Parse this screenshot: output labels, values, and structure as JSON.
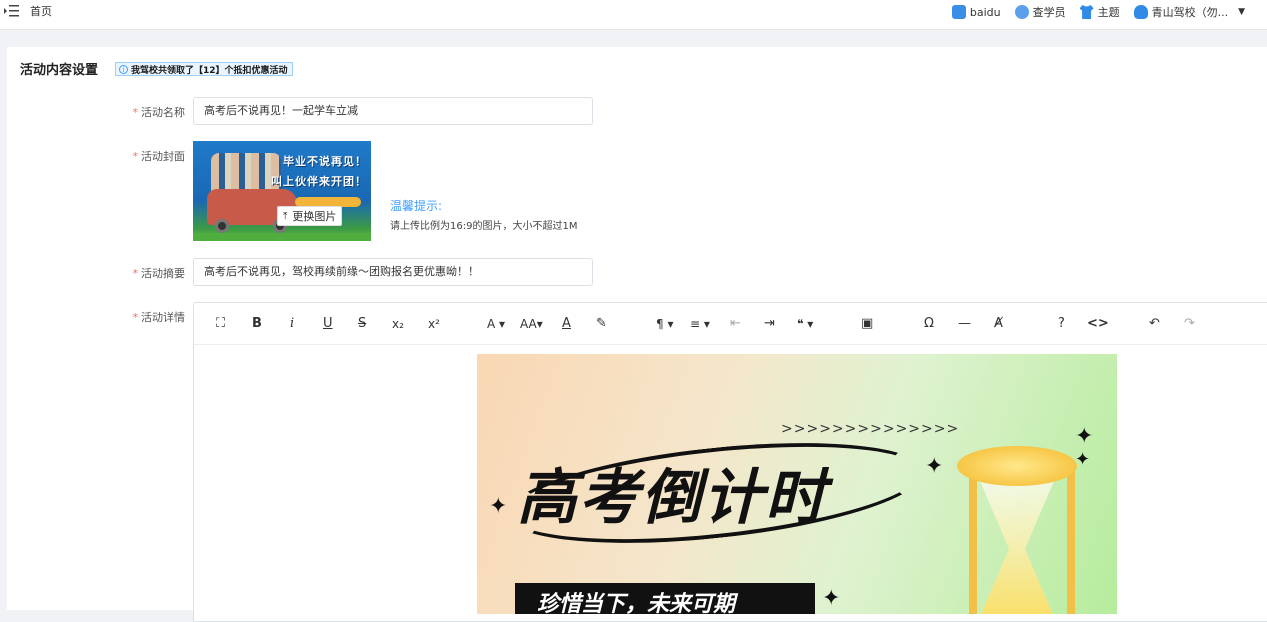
{
  "topbar": {
    "home": "首页",
    "items": [
      {
        "label": "baidu",
        "icon": "baidu-icon"
      },
      {
        "label": "查学员",
        "icon": "search-user-icon"
      },
      {
        "label": "主题",
        "icon": "theme-shirt-icon"
      },
      {
        "label": "青山驾校（勿...",
        "icon": "user-avatar-icon"
      }
    ]
  },
  "section": {
    "title": "活动内容设置",
    "notice": "我驾校共领取了【12】个抵扣优惠活动"
  },
  "form": {
    "name_label": "活动名称",
    "name_value": "高考后不说再见！一起学车立减",
    "cover_label": "活动封面",
    "cover_title_1": "毕业不说再见！",
    "cover_title_2": "叫上伙伴来开团！",
    "replace_label": "更换图片",
    "tip_title": "温馨提示:",
    "tip_text": "请上传比例为16:9的图片，大小不超过1M",
    "summary_label": "活动摘要",
    "summary_value": "高考后不说再见，驾校再续前缘～团购报名更优惠呦！！",
    "detail_label": "活动详情"
  },
  "editor": {
    "toolbar": [
      {
        "name": "fullscreen-button",
        "glyph": "⛶"
      },
      {
        "name": "bold-button",
        "glyph": "B"
      },
      {
        "name": "italic-button",
        "glyph": "i"
      },
      {
        "name": "underline-button",
        "glyph": "U"
      },
      {
        "name": "strikethrough-button",
        "glyph": "S"
      },
      {
        "name": "subscript-button",
        "glyph": "x₂"
      },
      {
        "name": "superscript-button",
        "glyph": "x²"
      },
      {
        "name": "font-color-button",
        "glyph": "A ▾"
      },
      {
        "name": "font-size-button",
        "glyph": "AA▾"
      },
      {
        "name": "background-color-button",
        "glyph": "A"
      },
      {
        "name": "clear-format-brush-button",
        "glyph": "✎"
      },
      {
        "name": "paragraph-button",
        "glyph": "¶ ▾"
      },
      {
        "name": "align-button",
        "glyph": "≡ ▾"
      },
      {
        "name": "outdent-button",
        "glyph": "⇤"
      },
      {
        "name": "indent-button",
        "glyph": "⇥"
      },
      {
        "name": "quote-button",
        "glyph": "❝ ▾"
      },
      {
        "name": "insert-image-button",
        "glyph": "▣"
      },
      {
        "name": "special-char-button",
        "glyph": "Ω"
      },
      {
        "name": "horizontal-line-button",
        "glyph": "—"
      },
      {
        "name": "remove-format-button",
        "glyph": "Ⱥ"
      },
      {
        "name": "help-button",
        "glyph": "?"
      },
      {
        "name": "code-view-button",
        "glyph": "<>"
      },
      {
        "name": "undo-button",
        "glyph": "↶"
      },
      {
        "name": "redo-button",
        "glyph": "↷"
      }
    ],
    "image": {
      "arrows": ">>>>>>>>>>>>>>",
      "headline": "高考倒计时",
      "subtitle": "珍惜当下，未来可期"
    }
  },
  "colors": {
    "accent": "#409eff",
    "required": "#f56c6c"
  }
}
